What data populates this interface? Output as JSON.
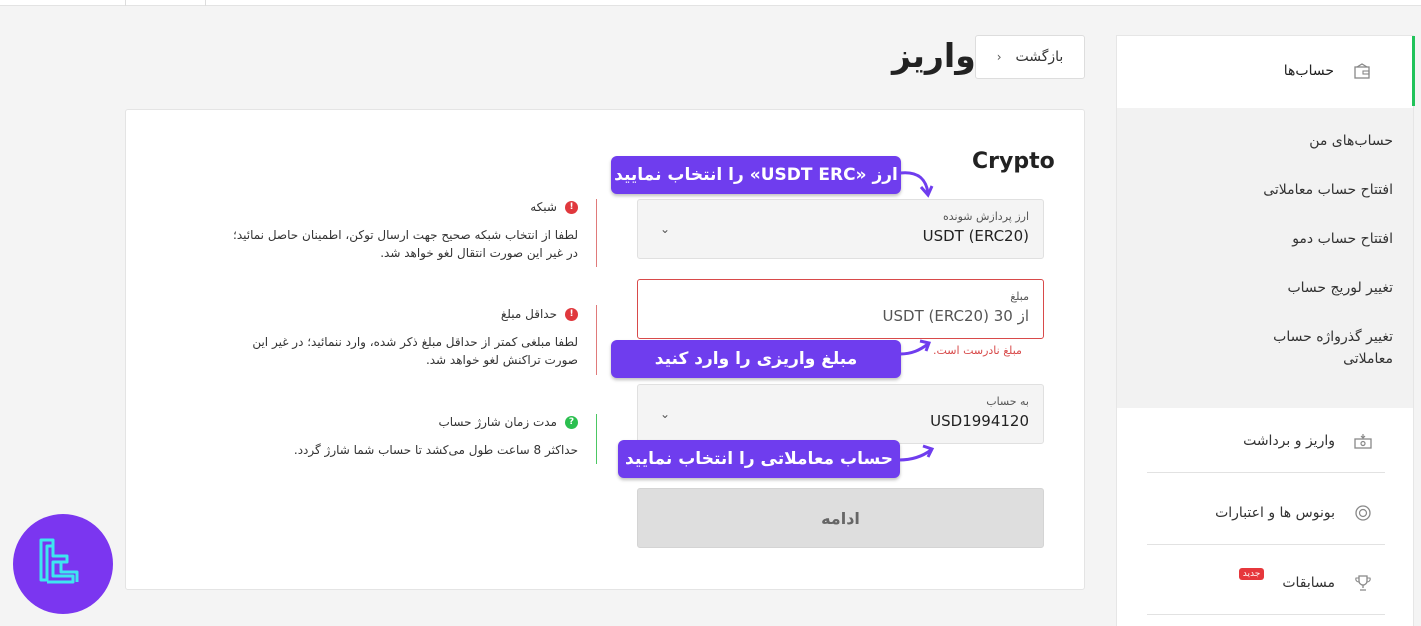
{
  "page": {
    "title": "واریز",
    "back_label": "بازگشت"
  },
  "sidebar": {
    "accounts": "حساب‌ها",
    "sub_items": [
      "حساب‌های من",
      "افتتاح حساب معاملاتی",
      "افتتاح حساب دمو",
      "تغییر لوریج حساب",
      "تغییر گذرواژه حساب معاملاتی"
    ],
    "deposit_withdraw": "واریز و برداشت",
    "bonuses": "بونوس ها و اعتبارات",
    "contests": "مسابقات",
    "new_badge": "جدید"
  },
  "form": {
    "section_title": "Crypto",
    "currency_label": "ارز پردازش شونده",
    "currency_value": "USDT (ERC20)",
    "amount_label": "مبلغ",
    "amount_placeholder": "از 30 USDT (ERC20)",
    "amount_error": "مبلغ نادرست است.",
    "account_label": "به حساب",
    "account_value": "USD1994120",
    "continue_label": "ادامه"
  },
  "info": {
    "network_title": "شبکه",
    "network_body_1": "لطفا از انتخاب شبکه صحیح جهت ارسال توکن، اطمینان حاصل نمائید؛",
    "network_body_2": "در غیر این صورت انتقال لغو خواهد شد.",
    "min_title": "حداقل مبلغ",
    "min_body_1": "لطفا مبلغی کمتر از حداقل مبلغ ذکر شده، وارد ننمائید؛ در غیر این",
    "min_body_2": "صورت تراکنش لغو خواهد شد.",
    "time_title": "مدت زمان شارژ حساب",
    "time_body": "حداکثر 8 ساعت طول می‌کشد تا حساب شما شارژ گردد."
  },
  "callouts": {
    "select_currency": "ارز «USDT ERC» را انتخاب نمایید",
    "enter_amount": "مبلغ واریزی را وارد کنید",
    "select_account": "حساب معاملاتی را انتخاب نمایید"
  },
  "colors": {
    "accent_green": "#21c35a",
    "error_red": "#d84a4a",
    "callout_purple": "#6f3dee",
    "info_green": "#2bbf4f"
  }
}
